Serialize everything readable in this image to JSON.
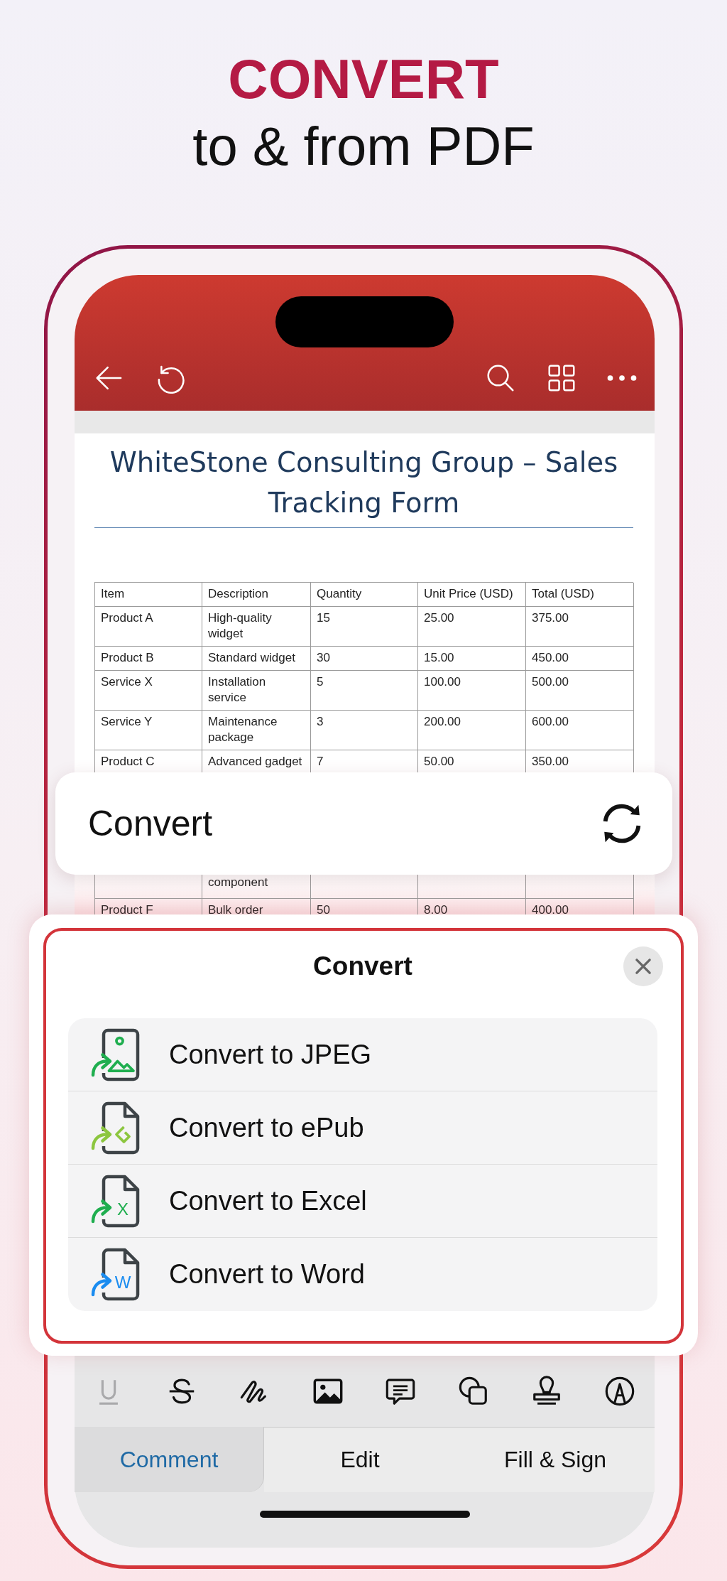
{
  "headline": {
    "title": "CONVERT",
    "subtitle": "to & from PDF"
  },
  "document": {
    "title": "WhiteStone Consulting Group – Sales Tracking Form",
    "table": {
      "columns": [
        "Item",
        "Description",
        "Quantity",
        "Unit Price (USD)",
        "Total (USD)"
      ],
      "rows_above": [
        {
          "cells": [
            "Product A",
            "High-quality widget",
            "15",
            "25.00",
            "375.00"
          ]
        },
        {
          "cells": [
            "Product B",
            "Standard widget",
            "30",
            "15.00",
            "450.00"
          ]
        },
        {
          "cells": [
            "Service X",
            "Installation service",
            "5",
            "100.00",
            "500.00"
          ]
        },
        {
          "cells": [
            "Service Y",
            "Maintenance package",
            "3",
            "200.00",
            "600.00"
          ]
        },
        {
          "cells": [
            "Product C",
            "Advanced gadget",
            "7",
            "50.00",
            "350.00"
          ]
        }
      ],
      "rows_below": [
        {
          "cells": [
            null,
            "component",
            null,
            null,
            null
          ]
        },
        {
          "cells": [
            "Product F",
            "Bulk order",
            "50",
            "8.00",
            "400.00"
          ]
        }
      ]
    }
  },
  "convert_card": {
    "label": "Convert"
  },
  "sheet": {
    "title": "Convert",
    "options": [
      {
        "kind": "image",
        "label": "Convert to JPEG",
        "color": "#1fae4f"
      },
      {
        "kind": "epub",
        "label": "Convert to ePub",
        "color": "#8cc63f"
      },
      {
        "kind": "letter",
        "label": "Convert to Excel",
        "color": "#1fae4f",
        "badge": "X"
      },
      {
        "kind": "letter",
        "label": "Convert to Word",
        "color": "#1a8cf0",
        "badge": "W"
      }
    ]
  },
  "toolbar": [
    {
      "kind": "underline",
      "disabled": true
    },
    {
      "kind": "strikethrough",
      "disabled": false
    },
    {
      "kind": "draw",
      "disabled": false
    },
    {
      "kind": "image",
      "disabled": false
    },
    {
      "kind": "note",
      "disabled": false
    },
    {
      "kind": "shapes",
      "disabled": false
    },
    {
      "kind": "stamp",
      "disabled": false
    },
    {
      "kind": "pen",
      "disabled": false
    }
  ],
  "tabs": [
    {
      "label": "Comment",
      "selected": true
    },
    {
      "label": "Edit",
      "selected": false
    },
    {
      "label": "Fill & Sign",
      "selected": false
    }
  ]
}
